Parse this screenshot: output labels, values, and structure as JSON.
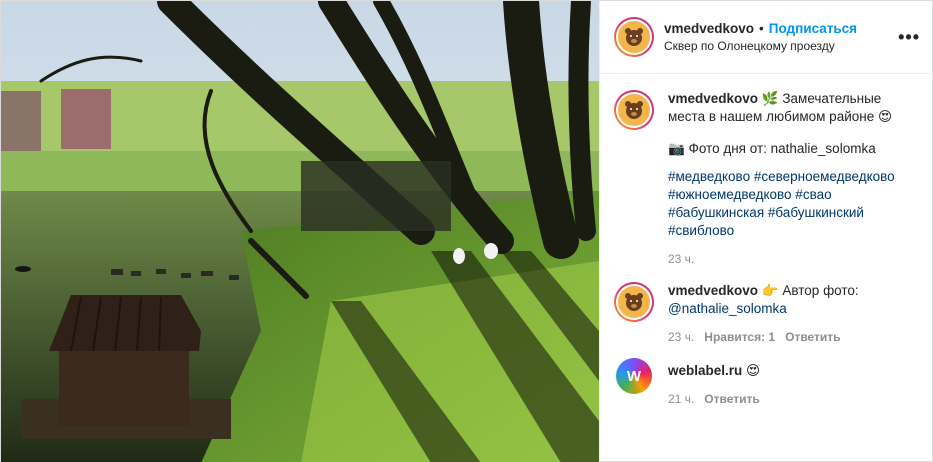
{
  "post": {
    "username": "vmedvedkovo",
    "separator": "•",
    "follow_label": "Подписаться",
    "location": "Сквер по Олонецкому проезду",
    "more_label": "•••"
  },
  "caption": {
    "username": "vmedvedkovo",
    "line1": "Замечательные места в нашем любимом районе",
    "photo_credit": "Фото дня от: nathalie_solomka",
    "hashtags": "#медведково #северноемедведково #южноемедведково #свао #бабушкинская #бабушкинский #свиблово",
    "time": "23 ч."
  },
  "comments": [
    {
      "username": "vmedvedkovo",
      "text_prefix": "Автор фото:",
      "mention": "@nathalie_solomka",
      "time": "23 ч.",
      "likes": "Нравится: 1",
      "reply": "Ответить"
    },
    {
      "username": "weblabel.ru",
      "time": "21 ч.",
      "reply": "Ответить"
    }
  ],
  "icons": {
    "avatar": "bear-face-icon",
    "leaf": "leaf-icon",
    "heart_eyes": "heart-eyes-emoji",
    "camera": "camera-emoji",
    "point": "pointing-hand-emoji",
    "weblabel": "weblabel-logo-icon"
  },
  "colors": {
    "link": "#0095f6",
    "hashtag": "#00376b",
    "muted": "#8e8e8e"
  }
}
